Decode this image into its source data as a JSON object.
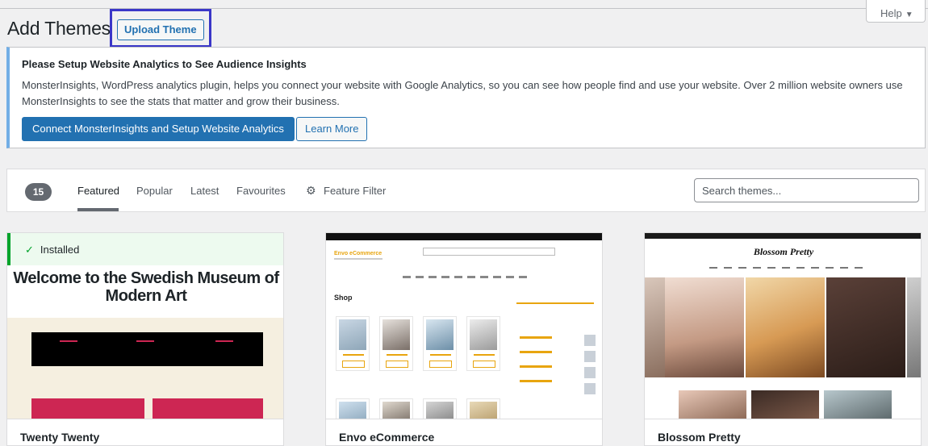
{
  "header": {
    "title": "Add Themes",
    "upload_label": "Upload Theme",
    "help_label": "Help"
  },
  "notice": {
    "title": "Please Setup Website Analytics to See Audience Insights",
    "text": "MonsterInsights, WordPress analytics plugin, helps you connect your website with Google Analytics, so you can see how people find and use your website. Over 2 million website owners use MonsterInsights to see the stats that matter and grow their business.",
    "primary_button": "Connect MonsterInsights and Setup Website Analytics",
    "secondary_button": "Learn More"
  },
  "filter": {
    "count": "15",
    "tabs": [
      {
        "label": "Featured",
        "active": true
      },
      {
        "label": "Popular"
      },
      {
        "label": "Latest"
      },
      {
        "label": "Favourites"
      }
    ],
    "feature_filter_label": "Feature Filter",
    "search_placeholder": "Search themes..."
  },
  "themes": [
    {
      "name": "Twenty Twenty",
      "installed_label": "Installed",
      "preview_heading": "Welcome to the Swedish Museum of Modern Art"
    },
    {
      "name": "Envo eCommerce",
      "preview_logo": "Envo eCommerce",
      "preview_section": "Shop"
    },
    {
      "name": "Blossom Pretty",
      "preview_logo": "Blossom Pretty"
    }
  ],
  "colors": {
    "accent": "#2271b1",
    "highlight_box": "#3a36c8",
    "installed_green": "#00a32a",
    "notice_border": "#72aee6"
  }
}
